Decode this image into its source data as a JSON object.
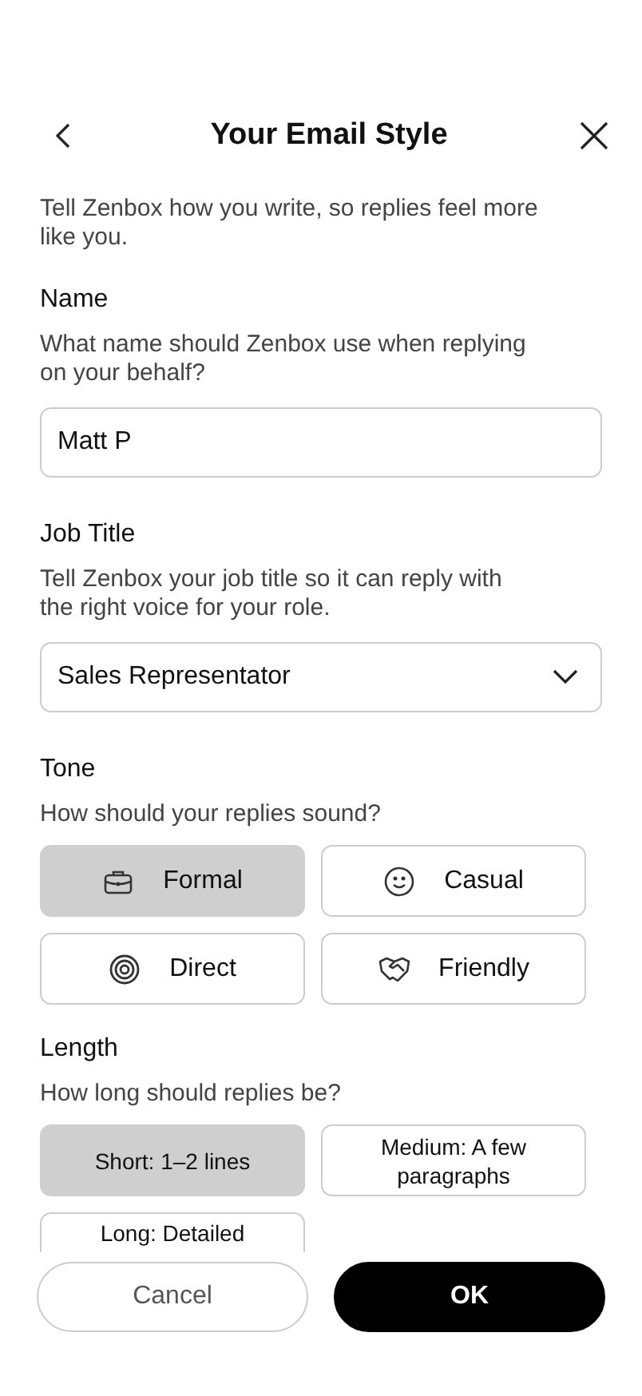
{
  "header": {
    "title": "Your Email Style"
  },
  "intro": "Tell Zenbox how you write, so replies feel more like you.",
  "name": {
    "label": "Name",
    "description": "What name should Zenbox use when replying on your behalf?",
    "value": "Matt P"
  },
  "job_title": {
    "label": "Job Title",
    "description": "Tell Zenbox your job title so it can reply with the right voice for your role.",
    "value": "Sales Representator"
  },
  "tone": {
    "label": "Tone",
    "description": "How should your replies sound?",
    "options": [
      {
        "label": "Formal",
        "selected": true
      },
      {
        "label": "Casual",
        "selected": false
      },
      {
        "label": "Direct",
        "selected": false
      },
      {
        "label": "Friendly",
        "selected": false
      }
    ]
  },
  "length": {
    "label": "Length",
    "description": "How long should replies be?",
    "options": [
      {
        "label": "Short: 1–2 lines",
        "selected": true
      },
      {
        "label": "Medium: A few paragraphs",
        "selected": false
      },
      {
        "label": "Long: Detailed",
        "selected": false
      }
    ]
  },
  "buttons": {
    "cancel": "Cancel",
    "ok": "OK"
  }
}
